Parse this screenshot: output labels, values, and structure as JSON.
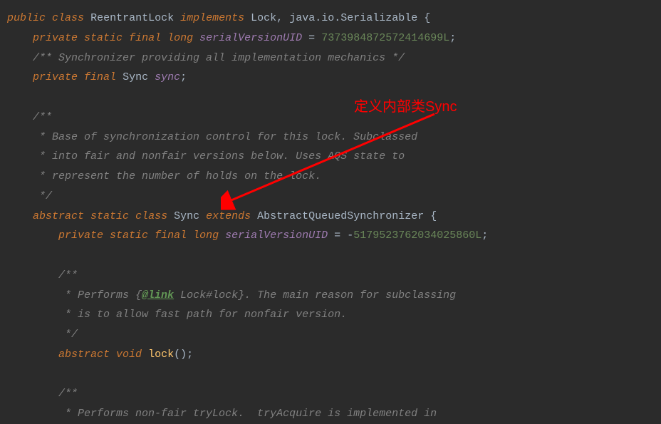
{
  "annotation": {
    "text": "定义内部类Sync"
  },
  "code": {
    "l1": {
      "kw_public": "public",
      "kw_class": "class",
      "name": "ReentrantLock",
      "kw_implements": "implements",
      "iface1": "Lock",
      "comma": ",",
      "iface2": "java.io.Serializable",
      "brace": " {"
    },
    "l2": {
      "kw_private": "private",
      "kw_static": "static",
      "kw_final": "final",
      "kw_long": "long",
      "field": "serialVersionUID",
      "eq": " = ",
      "num": "7373984872572414699L",
      "semi": ";"
    },
    "l3": {
      "comment": "/** Synchronizer providing all implementation mechanics */"
    },
    "l4": {
      "kw_private": "private",
      "kw_final": "final",
      "type": "Sync",
      "field": "sync",
      "semi": ";"
    },
    "l6": {
      "comment": "/**"
    },
    "l7": {
      "comment": " * Base of synchronization control for this lock. Subclassed"
    },
    "l8": {
      "comment": " * into fair and nonfair versions below. Uses AQS state to"
    },
    "l9": {
      "comment": " * represent the number of holds on the lock."
    },
    "l10": {
      "comment": " */"
    },
    "l11": {
      "kw_abstract": "abstract",
      "kw_static": "static",
      "kw_class": "class",
      "name": "Sync",
      "kw_extends": "extends",
      "superclass": "AbstractQueuedSynchronizer",
      "brace": " {"
    },
    "l12": {
      "kw_private": "private",
      "kw_static": "static",
      "kw_final": "final",
      "kw_long": "long",
      "field": "serialVersionUID",
      "eq": " = ",
      "minus": "-",
      "num": "5179523762034025860L",
      "semi": ";"
    },
    "l14": {
      "comment": "/**"
    },
    "l15": {
      "prefix": " * Performs {",
      "tag": "@link",
      "link": " Lock#lock",
      "suffix": "}. The main reason for subclassing"
    },
    "l16": {
      "comment": " * is to allow fast path for nonfair version."
    },
    "l17": {
      "comment": " */"
    },
    "l18": {
      "kw_abstract": "abstract",
      "kw_void": "void",
      "method": "lock",
      "parens": "();"
    },
    "l20": {
      "comment": "/**"
    },
    "l21": {
      "comment": " * Performs non-fair tryLock.  tryAcquire is implemented in"
    }
  }
}
